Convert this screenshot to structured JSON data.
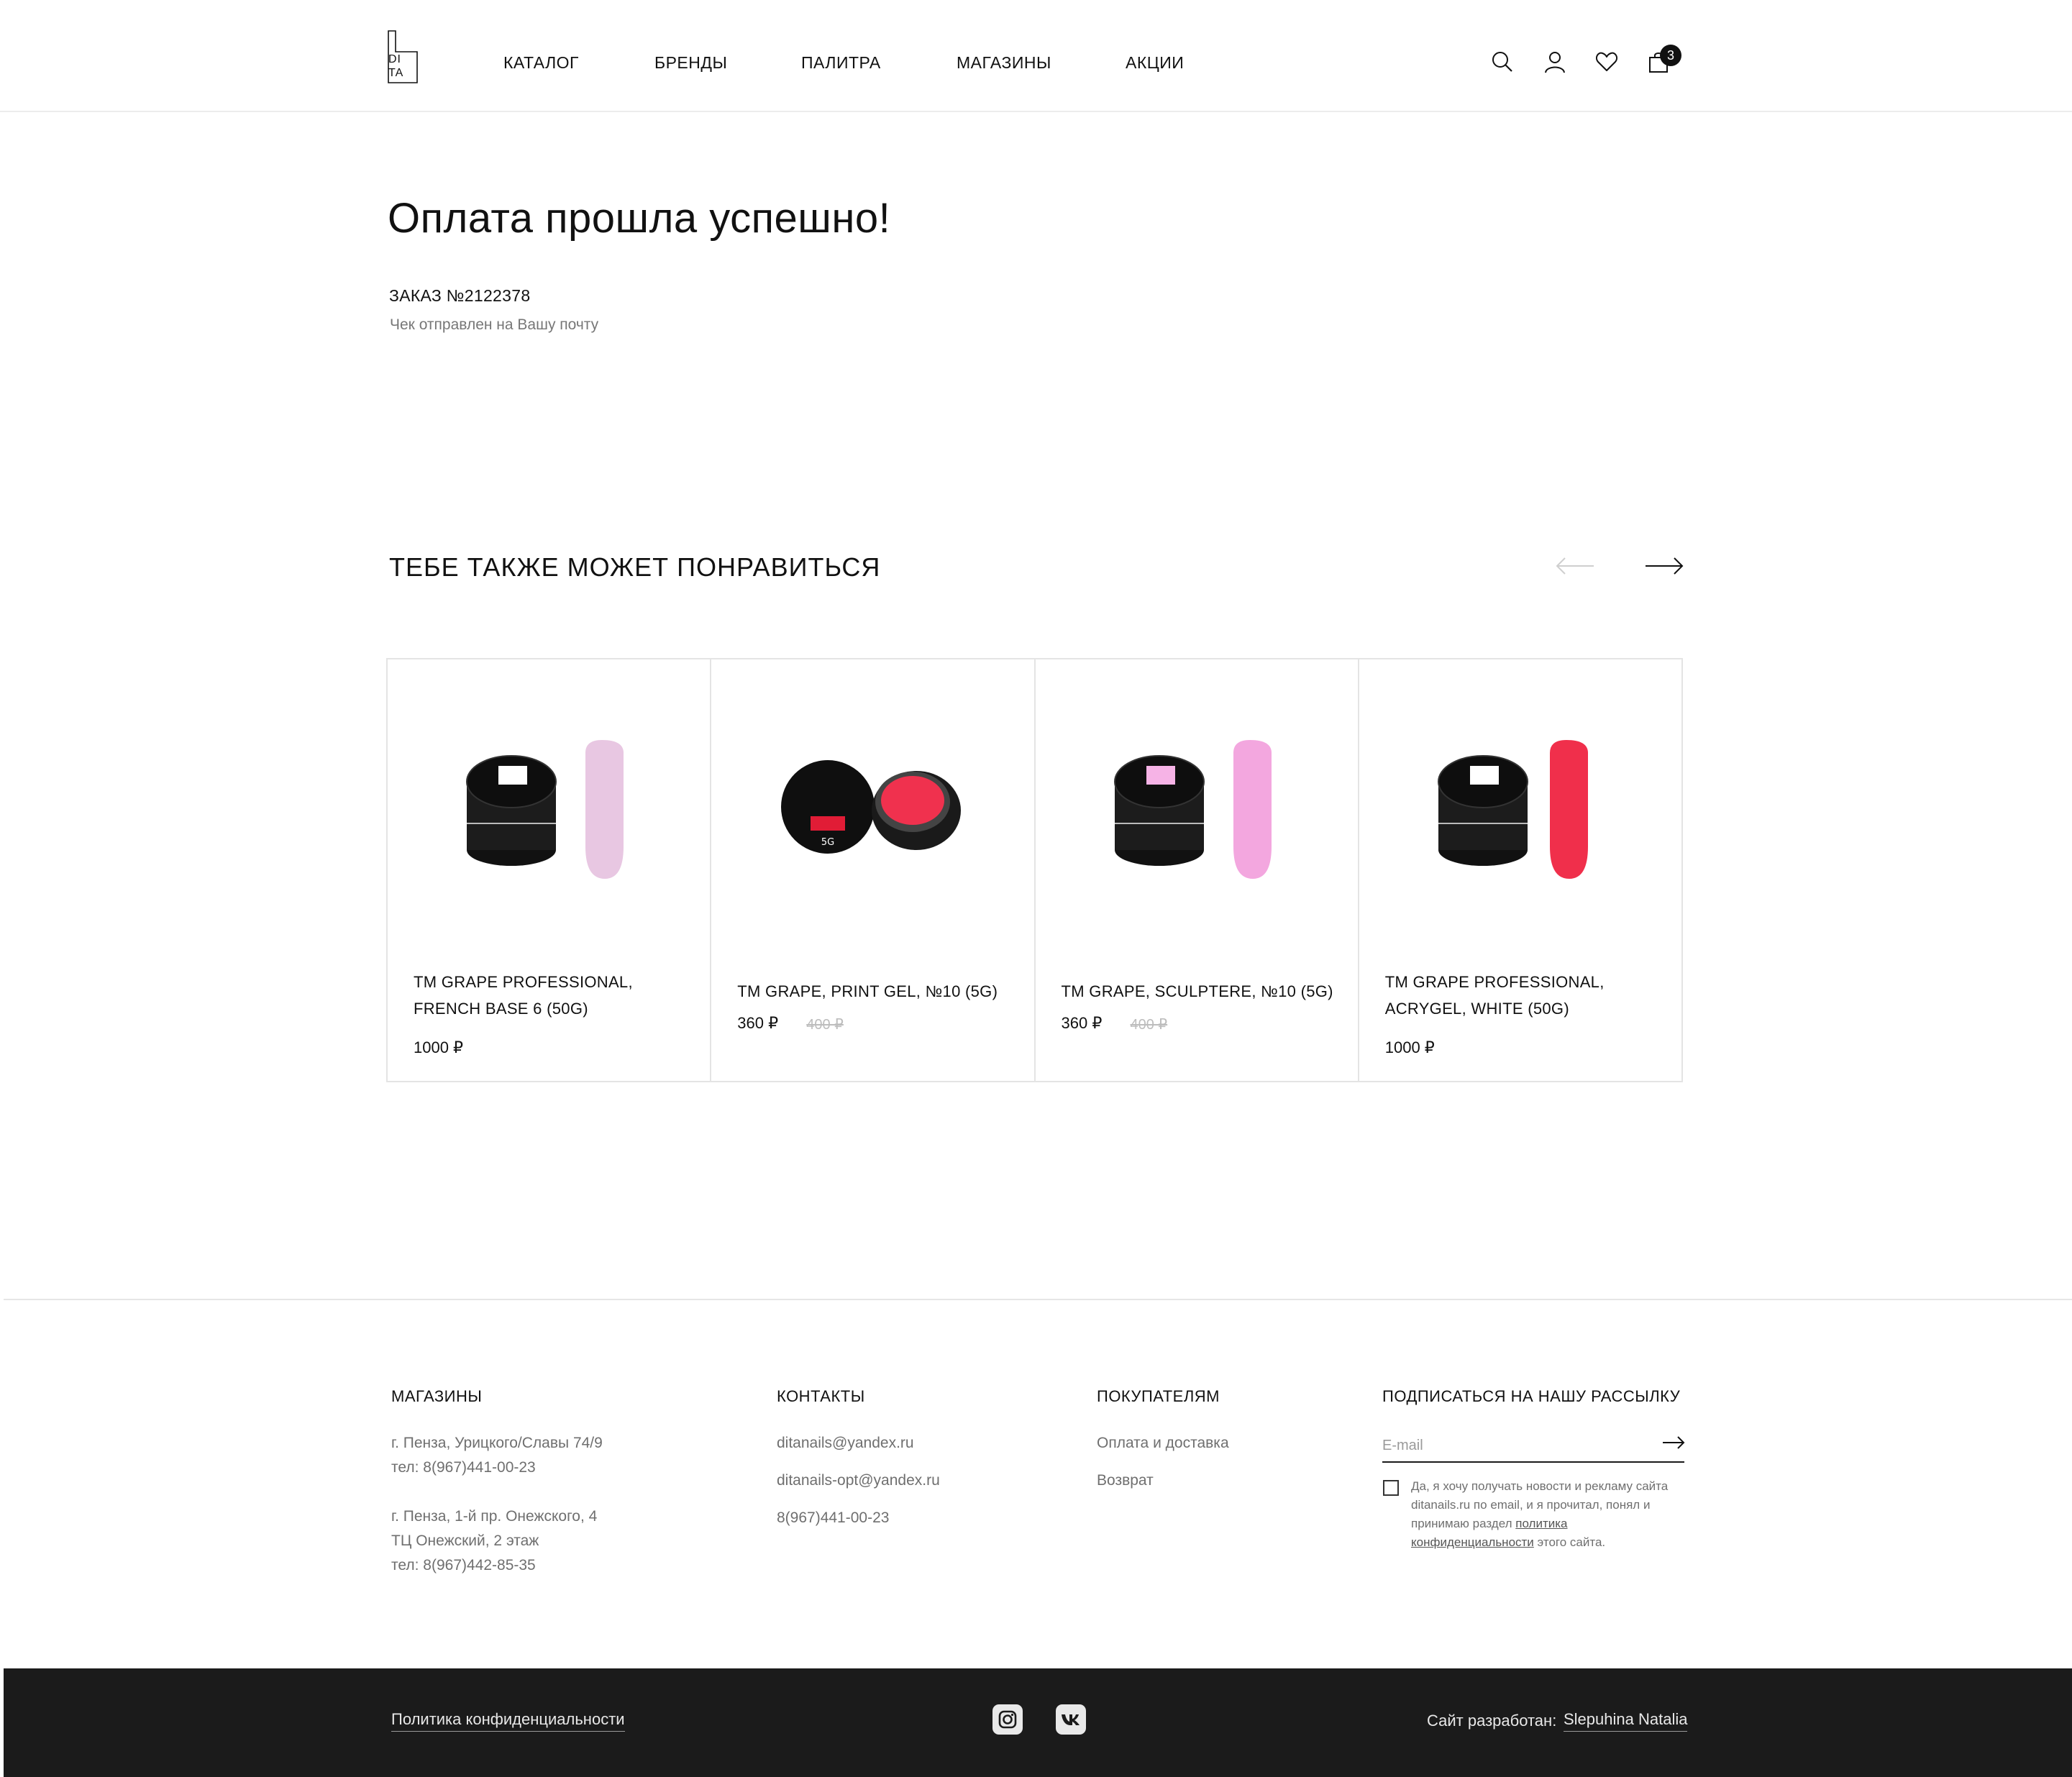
{
  "header": {
    "logo": {
      "top": "DI",
      "bottom": "TA"
    },
    "nav": [
      "КАТАЛОГ",
      "БРЕНДЫ",
      "ПАЛИТРА",
      "МАГАЗИНЫ",
      "АКЦИИ"
    ],
    "icons": [
      "search-icon",
      "user-icon",
      "heart-icon",
      "cart-icon"
    ],
    "cart_count": "3"
  },
  "main": {
    "title": "Оплата прошла успешно!",
    "order_number": "ЗАКАЗ №2122378",
    "order_note": "Чек отправлен на Вашу почту"
  },
  "recommendations": {
    "title": "ТЕБЕ ТАКЖЕ МОЖЕТ ПОНРАВИТЬСЯ",
    "products": [
      {
        "name": "TM GRAPE PROFESSIONAL, FRENCH BASE 6 (50G)",
        "price": "1000 ₽",
        "old_price": "",
        "color": "#e8c7e2"
      },
      {
        "name": "TM GRAPE, PRINT GEL, №10 (5G)",
        "price": "360 ₽",
        "old_price": "400 ₽",
        "color": "#f0314e"
      },
      {
        "name": "TM GRAPE, SCULPTERE, №10 (5G)",
        "price": "360 ₽",
        "old_price": "400 ₽",
        "color": "#f3a7df"
      },
      {
        "name": "TM GRAPE PROFESSIONAL, ACRYGEL, WHITE (50G)",
        "price": "1000 ₽",
        "old_price": "",
        "color": "#f02f4b"
      }
    ]
  },
  "footer": {
    "stores": {
      "title": "МАГАЗИНЫ",
      "store1_address": "г. Пенза, Урицкого/Славы 74/9",
      "store1_phone": "тел: 8(967)441-00-23",
      "store2_address": "г. Пенза, 1-й пр. Онежского, 4",
      "store2_mall": "ТЦ Онежский, 2 этаж",
      "store2_phone": "тел: 8(967)442-85-35"
    },
    "contacts": {
      "title": "КОНТАКТЫ",
      "email1": "ditanails@yandex.ru",
      "email2": "ditanails-opt@yandex.ru",
      "phone": "8(967)441-00-23"
    },
    "customers": {
      "title": "ПОКУПАТЕЛЯМ",
      "link1": "Оплата и доставка",
      "link2": "Возврат"
    },
    "newsletter": {
      "title": "ПОДПИСАТЬСЯ НА НАШУ РАССЫЛКУ",
      "placeholder": "E-mail",
      "consent_text": "Да, я хочу получать новости и рекламу сайта ditanails.ru по email, и я прочитал, понял и принимаю раздел",
      "consent_link": "политика конфиденциальности",
      "consent_tail": "этого сайта."
    }
  },
  "bottom_bar": {
    "privacy": "Политика конфиденциальности",
    "social": [
      "instagram-icon",
      "vk-icon"
    ],
    "developed_label": "Сайт разработан:",
    "developer": "Slepuhina Natalia"
  },
  "colors": {
    "accent": "#1b1b1b",
    "muted_text": "#6f6f6f",
    "border": "#e4e4e4"
  }
}
